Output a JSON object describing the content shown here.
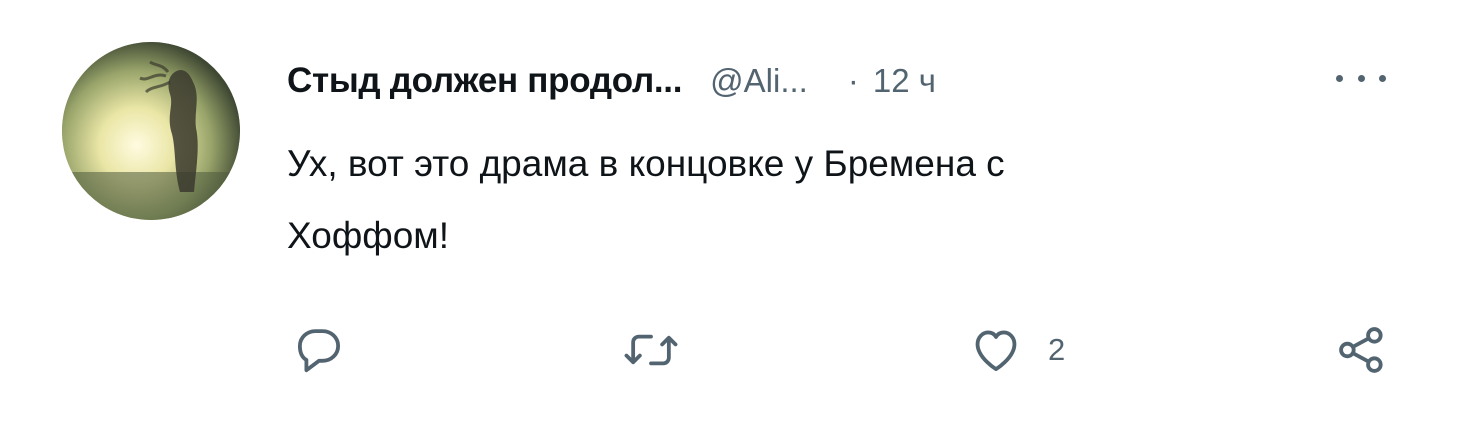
{
  "tweet": {
    "author": {
      "display_name": "Стыд должен продол...",
      "handle": "@Ali...",
      "separator": "·",
      "time": "12 ч"
    },
    "text_line1": "Ух, вот это драма в концовке у Бремена с",
    "text_line2": "Хоффом!",
    "actions": {
      "reply_icon": "reply-icon",
      "retweet_icon": "retweet-icon",
      "like_icon": "heart-icon",
      "like_count": "2",
      "share_icon": "share-icon"
    },
    "more_icon": "more-icon"
  }
}
